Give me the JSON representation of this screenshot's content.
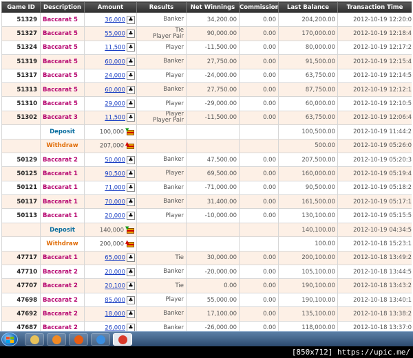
{
  "columns": [
    "Game ID",
    "Description",
    "Amount",
    "Results",
    "Net Winnings",
    "Commission",
    "Last Balance",
    "Transaction Time"
  ],
  "rows": [
    {
      "game_id": "51329",
      "description": "Baccarat 5",
      "amount": "36,000",
      "results": [
        "Banker"
      ],
      "net": "34,200.00",
      "commission": "0.00",
      "balance": "204,200.00",
      "time": "2012-10-19 12:20:0",
      "kind": "game"
    },
    {
      "game_id": "51327",
      "description": "Baccarat 5",
      "amount": "55,000",
      "results": [
        "Tie",
        "Player Pair"
      ],
      "net": "90,000.00",
      "commission": "0.00",
      "balance": "170,000.00",
      "time": "2012-10-19 12:18:4",
      "kind": "game"
    },
    {
      "game_id": "51324",
      "description": "Baccarat 5",
      "amount": "11,500",
      "results": [
        "Player"
      ],
      "net": "-11,500.00",
      "commission": "0.00",
      "balance": "80,000.00",
      "time": "2012-10-19 12:17:2",
      "kind": "game"
    },
    {
      "game_id": "51319",
      "description": "Baccarat 5",
      "amount": "60,000",
      "results": [
        "Banker"
      ],
      "net": "27,750.00",
      "commission": "0.00",
      "balance": "91,500.00",
      "time": "2012-10-19 12:15:4",
      "kind": "game"
    },
    {
      "game_id": "51317",
      "description": "Baccarat 5",
      "amount": "24,000",
      "results": [
        "Player"
      ],
      "net": "-24,000.00",
      "commission": "0.00",
      "balance": "63,750.00",
      "time": "2012-10-19 12:14:5",
      "kind": "game"
    },
    {
      "game_id": "51313",
      "description": "Baccarat 5",
      "amount": "60,000",
      "results": [
        "Banker"
      ],
      "net": "27,750.00",
      "commission": "0.00",
      "balance": "87,750.00",
      "time": "2012-10-19 12:12:1",
      "kind": "game"
    },
    {
      "game_id": "51310",
      "description": "Baccarat 5",
      "amount": "29,000",
      "results": [
        "Player"
      ],
      "net": "-29,000.00",
      "commission": "0.00",
      "balance": "60,000.00",
      "time": "2012-10-19 12:10:5",
      "kind": "game"
    },
    {
      "game_id": "51302",
      "description": "Baccarat 3",
      "amount": "11,500",
      "results": [
        "Player",
        "Player Pair"
      ],
      "net": "-11,500.00",
      "commission": "0.00",
      "balance": "63,750.00",
      "time": "2012-10-19 12:06:4",
      "kind": "game"
    },
    {
      "game_id": "",
      "description": "Deposit",
      "amount": "100,000",
      "results": [],
      "net": "",
      "commission": "",
      "balance": "100,500.00",
      "time": "2012-10-19 11:44:2",
      "kind": "deposit"
    },
    {
      "game_id": "",
      "description": "Withdraw",
      "amount": "207,000",
      "results": [],
      "net": "",
      "commission": "",
      "balance": "500.00",
      "time": "2012-10-19 05:26:0",
      "kind": "withdraw"
    },
    {
      "game_id": "50129",
      "description": "Baccarat 2",
      "amount": "50,000",
      "results": [
        "Banker"
      ],
      "net": "47,500.00",
      "commission": "0.00",
      "balance": "207,500.00",
      "time": "2012-10-19 05:20:3",
      "kind": "game"
    },
    {
      "game_id": "50125",
      "description": "Baccarat 1",
      "amount": "90,500",
      "results": [
        "Player"
      ],
      "net": "69,500.00",
      "commission": "0.00",
      "balance": "160,000.00",
      "time": "2012-10-19 05:19:4",
      "kind": "game"
    },
    {
      "game_id": "50121",
      "description": "Baccarat 1",
      "amount": "71,000",
      "results": [
        "Banker"
      ],
      "net": "-71,000.00",
      "commission": "0.00",
      "balance": "90,500.00",
      "time": "2012-10-19 05:18:2",
      "kind": "game"
    },
    {
      "game_id": "50117",
      "description": "Baccarat 1",
      "amount": "70,000",
      "results": [
        "Banker"
      ],
      "net": "31,400.00",
      "commission": "0.00",
      "balance": "161,500.00",
      "time": "2012-10-19 05:17:1",
      "kind": "game"
    },
    {
      "game_id": "50113",
      "description": "Baccarat 1",
      "amount": "20,000",
      "results": [
        "Player"
      ],
      "net": "-10,000.00",
      "commission": "0.00",
      "balance": "130,100.00",
      "time": "2012-10-19 05:15:5",
      "kind": "game"
    },
    {
      "game_id": "",
      "description": "Deposit",
      "amount": "140,000",
      "results": [],
      "net": "",
      "commission": "",
      "balance": "140,100.00",
      "time": "2012-10-19 04:34:5",
      "kind": "deposit"
    },
    {
      "game_id": "",
      "description": "Withdraw",
      "amount": "200,000",
      "results": [],
      "net": "",
      "commission": "",
      "balance": "100.00",
      "time": "2012-10-18 15:23:1",
      "kind": "withdraw"
    },
    {
      "game_id": "47717",
      "description": "Baccarat 1",
      "amount": "65,000",
      "results": [
        "Tie"
      ],
      "net": "30,000.00",
      "commission": "0.00",
      "balance": "200,100.00",
      "time": "2012-10-18 13:49:2",
      "kind": "game"
    },
    {
      "game_id": "47710",
      "description": "Baccarat 2",
      "amount": "20,000",
      "results": [
        "Banker"
      ],
      "net": "-20,000.00",
      "commission": "0.00",
      "balance": "105,100.00",
      "time": "2012-10-18 13:44:5",
      "kind": "game"
    },
    {
      "game_id": "47707",
      "description": "Baccarat 2",
      "amount": "20,100",
      "results": [
        "Tie"
      ],
      "net": "0.00",
      "commission": "0.00",
      "balance": "190,100.00",
      "time": "2012-10-18 13:43:2",
      "kind": "game"
    },
    {
      "game_id": "47698",
      "description": "Baccarat 2",
      "amount": "85,000",
      "results": [
        "Player"
      ],
      "net": "55,000.00",
      "commission": "0.00",
      "balance": "190,100.00",
      "time": "2012-10-18 13:40:1",
      "kind": "game"
    },
    {
      "game_id": "47692",
      "description": "Baccarat 2",
      "amount": "18,000",
      "results": [
        "Banker"
      ],
      "net": "17,100.00",
      "commission": "0.00",
      "balance": "135,100.00",
      "time": "2012-10-18 13:38:2",
      "kind": "game"
    },
    {
      "game_id": "47687",
      "description": "Baccarat 2",
      "amount": "26,000",
      "results": [
        "Banker"
      ],
      "net": "-26,000.00",
      "commission": "0.00",
      "balance": "118,000.00",
      "time": "2012-10-18 13:37:0",
      "kind": "game"
    }
  ],
  "icons": {
    "game_amount": "club-icon",
    "deposit_amount": "deposit-chest-icon",
    "withdraw_amount": "withdraw-chest-icon"
  },
  "taskbar": {
    "items": [
      {
        "name": "windows-explorer-icon",
        "color": "#e8c25a"
      },
      {
        "name": "media-app-icon",
        "color": "#f08a24"
      },
      {
        "name": "firefox-icon",
        "color": "#e85d12"
      },
      {
        "name": "internet-explorer-icon",
        "color": "#3a8ee0"
      },
      {
        "name": "chrome-icon",
        "color": "#d93a2b"
      }
    ]
  },
  "watermark": "[850x712] https://upic.me/",
  "colors": {
    "game_desc": "#b5006e",
    "deposit_desc": "#0b6fa0",
    "withdraw_desc": "#e06a00",
    "link": "#1a3fc4",
    "row_alt": "#fdf0e6"
  }
}
